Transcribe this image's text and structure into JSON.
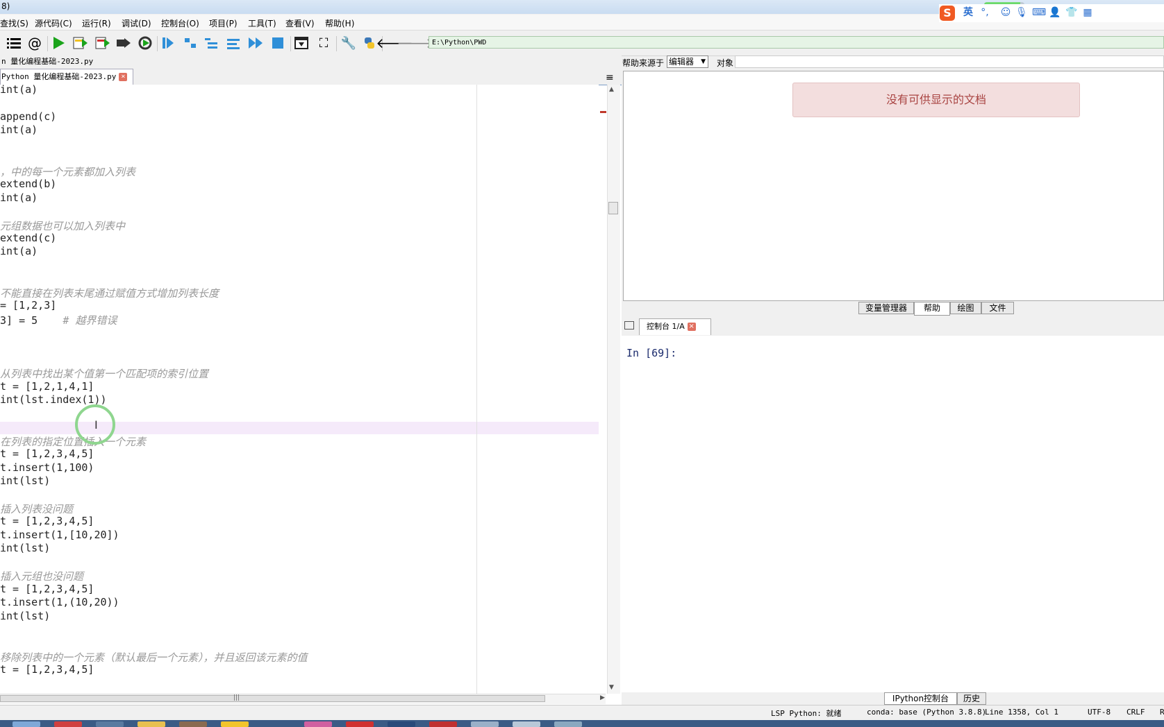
{
  "window": {
    "title_fragment": "8)",
    "title_progress": 0.9
  },
  "menu": [
    {
      "label": "查找(S)"
    },
    {
      "label": "源代码(C)"
    },
    {
      "label": "运行(R)"
    },
    {
      "label": "调试(D)"
    },
    {
      "label": "控制台(O)"
    },
    {
      "label": "项目(P)"
    },
    {
      "label": "工具(T)"
    },
    {
      "label": "查看(V)"
    },
    {
      "label": "帮助(H)"
    }
  ],
  "toolbar": {
    "path": "E:\\Python\\PWD",
    "icons": [
      "list-icon",
      "at-icon",
      "run-icon",
      "run-cell-icon",
      "run-cell-advance-icon",
      "run-selection-icon",
      "rerun-icon",
      "debug-icon",
      "step-icon",
      "step-into-icon",
      "step-return-icon",
      "continue-icon",
      "stop-icon",
      "maximize-pane-icon",
      "fullscreen-icon",
      "preferences-icon",
      "python-path-icon",
      "back-icon",
      "forward-icon"
    ]
  },
  "ime": {
    "logo": "S",
    "lang": "英",
    "punct": "°,",
    "icons": [
      "emoji-icon",
      "mic-icon",
      "keyboard-icon",
      "user-icon",
      "skin-icon",
      "grid-icon"
    ]
  },
  "editor": {
    "file_path": "n 量化编程基础-2023.py",
    "tab_label": "Python 量化编程基础-2023.py",
    "tab_close": "×",
    "menu_icon": "≡",
    "lines": [
      {
        "code": "int(a)",
        "comment": ""
      },
      {
        "code": "",
        "comment": ""
      },
      {
        "code": "append(c)",
        "comment": ""
      },
      {
        "code": "int(a)",
        "comment": ""
      },
      {
        "code": "",
        "comment": ""
      },
      {
        "code": "",
        "comment": ""
      },
      {
        "code": "",
        "comment": "，中的每一个元素都加入列表"
      },
      {
        "code": "extend(b)",
        "comment": ""
      },
      {
        "code": "int(a)",
        "comment": ""
      },
      {
        "code": "",
        "comment": ""
      },
      {
        "code": "",
        "comment": "元组数据也可以加入列表中"
      },
      {
        "code": "extend(c)",
        "comment": ""
      },
      {
        "code": "int(a)",
        "comment": ""
      },
      {
        "code": "",
        "comment": ""
      },
      {
        "code": "",
        "comment": ""
      },
      {
        "code": "",
        "comment": "不能直接在列表末尾通过赋值方式增加列表长度"
      },
      {
        "code": "= [1,2,3]",
        "comment": ""
      },
      {
        "code": "3] = 5    ",
        "comment": "# 越界错误"
      },
      {
        "code": "",
        "comment": ""
      },
      {
        "code": "",
        "comment": ""
      },
      {
        "code": "",
        "comment": ""
      },
      {
        "code": "",
        "comment": "从列表中找出某个值第一个匹配项的索引位置"
      },
      {
        "code": "t = [1,2,1,4,1]",
        "comment": ""
      },
      {
        "code": "int(lst.index(1))",
        "comment": ""
      },
      {
        "code": "",
        "comment": ""
      },
      {
        "code": "",
        "comment": ""
      },
      {
        "code": "",
        "comment": "在列表的指定位置插入一个元素"
      },
      {
        "code": "t = [1,2,3,4,5]",
        "comment": ""
      },
      {
        "code": "t.insert(1,100)",
        "comment": ""
      },
      {
        "code": "int(lst)",
        "comment": ""
      },
      {
        "code": "",
        "comment": ""
      },
      {
        "code": "",
        "comment": "插入列表没问题"
      },
      {
        "code": "t = [1,2,3,4,5]",
        "comment": ""
      },
      {
        "code": "t.insert(1,[10,20])",
        "comment": ""
      },
      {
        "code": "int(lst)",
        "comment": ""
      },
      {
        "code": "",
        "comment": ""
      },
      {
        "code": "",
        "comment": "插入元组也没问题"
      },
      {
        "code": "t = [1,2,3,4,5]",
        "comment": ""
      },
      {
        "code": "t.insert(1,(10,20))",
        "comment": ""
      },
      {
        "code": "int(lst)",
        "comment": ""
      },
      {
        "code": "",
        "comment": ""
      },
      {
        "code": "",
        "comment": ""
      },
      {
        "code": "",
        "comment": "移除列表中的一个元素（默认最后一个元素），并且返回该元素的值"
      },
      {
        "code": "t = [1,2,3,4,5]",
        "comment": ""
      }
    ]
  },
  "help": {
    "source_label": "帮助来源于",
    "source_value": "编辑器",
    "object_label": "对象",
    "object_value": "",
    "empty_message": "没有可供显示的文档"
  },
  "pane_tabs": [
    {
      "label": "变量管理器",
      "active": false
    },
    {
      "label": "帮助",
      "active": true
    },
    {
      "label": "绘图",
      "active": false
    },
    {
      "label": "文件",
      "active": false
    }
  ],
  "console": {
    "tab_label": "控制台 1/A",
    "tab_close": "×",
    "prompt": "In [69]:"
  },
  "bottom_tabs": [
    {
      "label": "IPython控制台",
      "active": true
    },
    {
      "label": "历史",
      "active": false
    }
  ],
  "status": {
    "lsp": "LSP Python: 就绪",
    "conda": "conda: base (Python 3.8.8)",
    "position": "Line 1358, Col 1",
    "encoding": "UTF-8",
    "eol": "CRLF",
    "extra": "R"
  },
  "colors": {
    "accent": "#2f8fd8",
    "run_green": "#1aa31a",
    "error_red": "#c0392b",
    "comment": "#999999"
  }
}
